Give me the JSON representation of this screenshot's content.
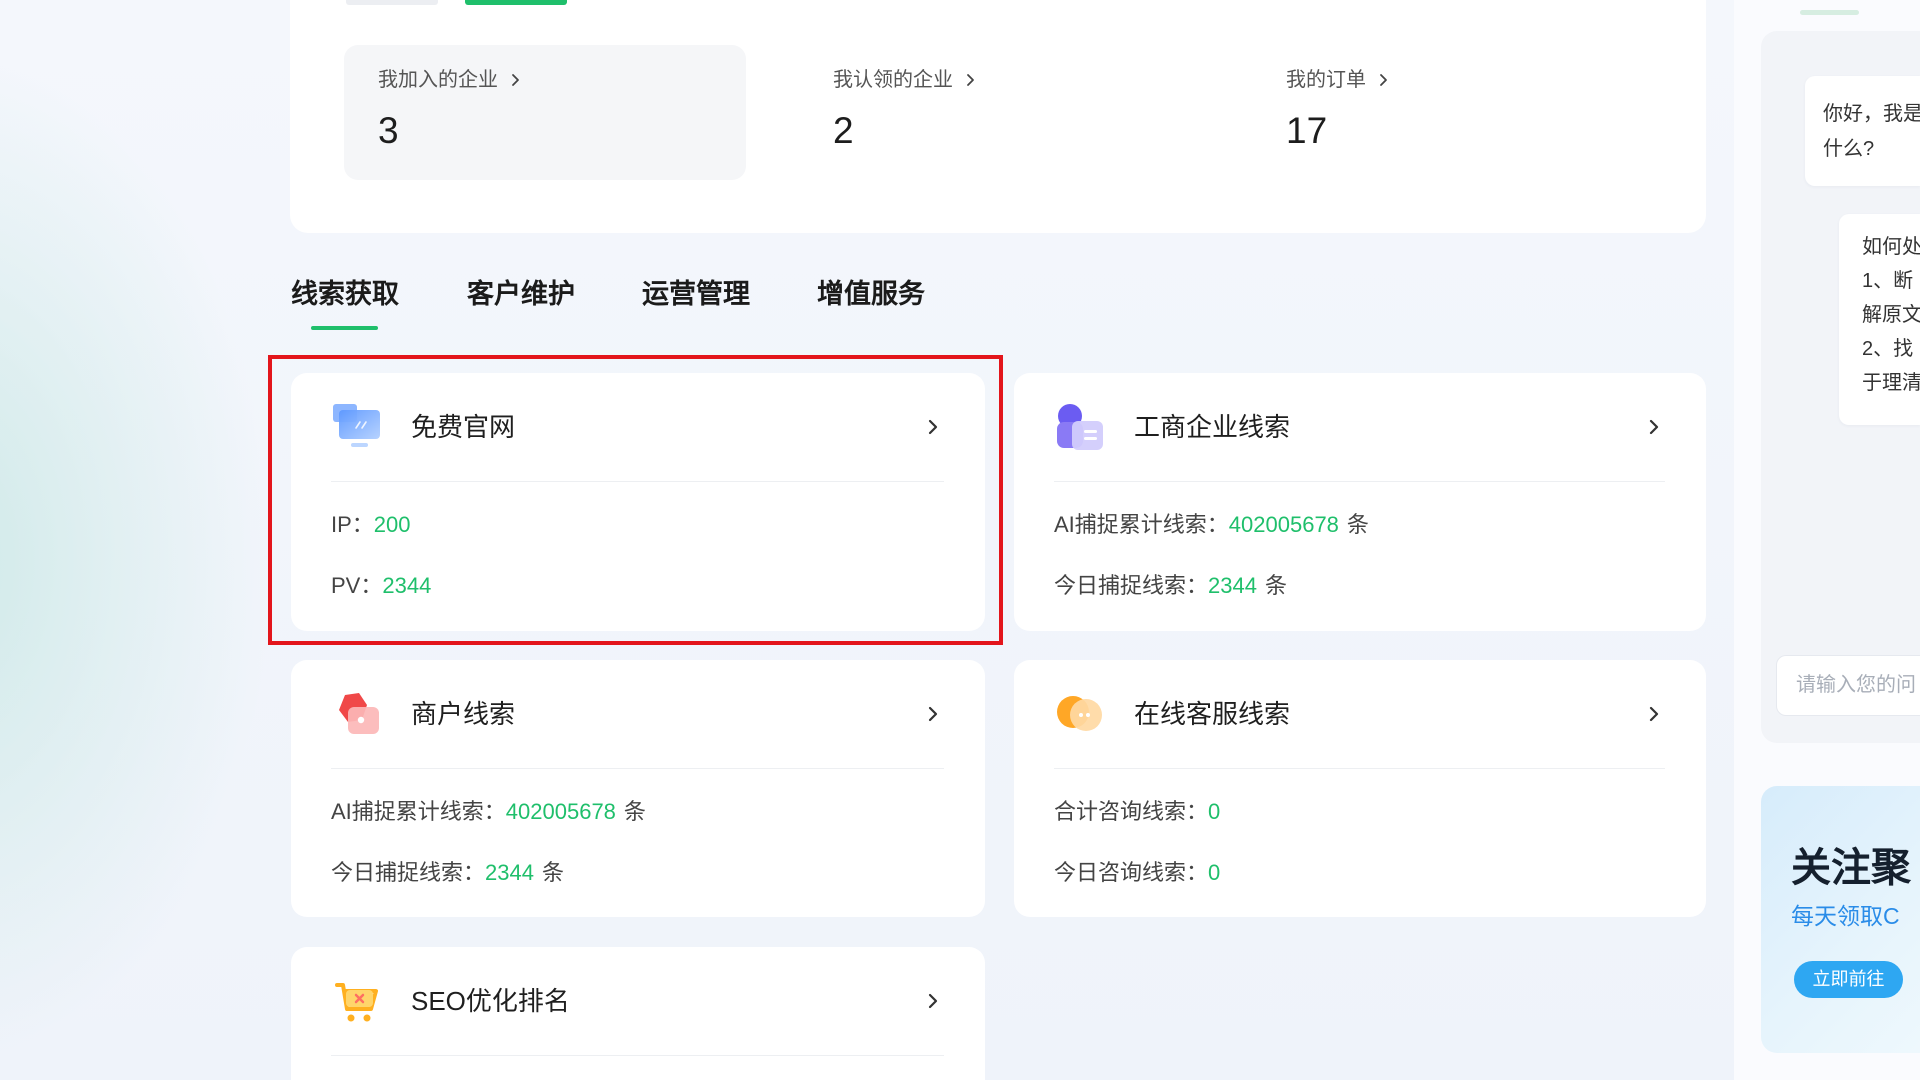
{
  "theme": {
    "accent": "#1fbf6b",
    "highlight_border": "#e3151b",
    "promo_blue": "#2a8ce8"
  },
  "stats": [
    {
      "label": "我加入的企业",
      "value": "3"
    },
    {
      "label": "我认领的企业",
      "value": "2"
    },
    {
      "label": "我的订单",
      "value": "17"
    }
  ],
  "tabs": [
    {
      "label": "线索获取",
      "active": true
    },
    {
      "label": "客户维护",
      "active": false
    },
    {
      "label": "运营管理",
      "active": false
    },
    {
      "label": "增值服务",
      "active": false
    }
  ],
  "cards": [
    {
      "title": "免费官网",
      "icon": "monitor-icon",
      "rows": [
        {
          "label": "IP：",
          "value": "200"
        },
        {
          "label": "PV：",
          "value": "2344"
        }
      ]
    },
    {
      "title": "工商企业线索",
      "icon": "enterprise-icon",
      "rows": [
        {
          "label": "AI捕捉累计线索：",
          "value": "402005678",
          "unit": "条"
        },
        {
          "label": "今日捕捉线索：",
          "value": "2344",
          "unit": "条"
        }
      ]
    },
    {
      "title": "商户线索",
      "icon": "merchant-tag-icon",
      "rows": [
        {
          "label": "AI捕捉累计线索：",
          "value": "402005678",
          "unit": "条"
        },
        {
          "label": "今日捕捉线索：",
          "value": "2344",
          "unit": "条"
        }
      ]
    },
    {
      "title": "在线客服线索",
      "icon": "chat-bubbles-icon",
      "rows": [
        {
          "label": "合计咨询线索：",
          "value": "0"
        },
        {
          "label": "今日咨询线索：",
          "value": "0"
        }
      ]
    },
    {
      "title": "SEO优化排名",
      "icon": "shopping-cart-icon",
      "rows": []
    }
  ],
  "assistant": {
    "messages": [
      {
        "lines": [
          "你好，我是",
          "什么?"
        ]
      },
      {
        "lines": [
          "如何处",
          "1、断",
          "解原文",
          "2、找",
          "于理清"
        ]
      }
    ],
    "input_placeholder": "请输入您的问"
  },
  "promo": {
    "title": "关注聚",
    "subtitle": "每天领取C",
    "button_label": "立即前往"
  }
}
